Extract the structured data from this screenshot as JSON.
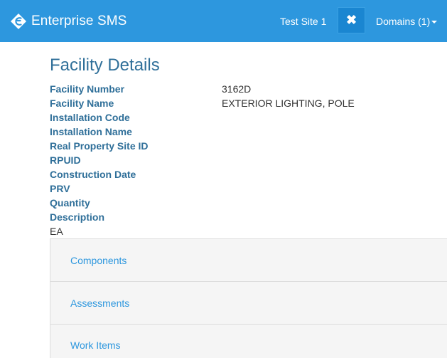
{
  "header": {
    "app_name": "Enterprise SMS",
    "site_name": "Test Site 1",
    "close_symbol": "✖",
    "domains_label": "Domains (1)",
    "logo_icon": "enterprise-sms-logo",
    "colors": {
      "navbar": "#2d97de",
      "close_button": "#1a86d1"
    }
  },
  "page": {
    "title": "Facility Details"
  },
  "details": [
    {
      "label": "Facility Number",
      "value": "3162D"
    },
    {
      "label": "Facility Name",
      "value": "EXTERIOR LIGHTING, POLE"
    },
    {
      "label": "Installation Code",
      "value": ""
    },
    {
      "label": "Installation Name",
      "value": ""
    },
    {
      "label": "Real Property Site ID",
      "value": ""
    },
    {
      "label": "RPUID",
      "value": ""
    },
    {
      "label": "Construction Date",
      "value": ""
    },
    {
      "label": "PRV",
      "value": ""
    },
    {
      "label": "Quantity",
      "value": ""
    },
    {
      "label": "Description",
      "value": ""
    }
  ],
  "quantity_unit": "EA",
  "panels": [
    {
      "label": "Components"
    },
    {
      "label": "Assessments"
    },
    {
      "label": "Work Items"
    }
  ]
}
